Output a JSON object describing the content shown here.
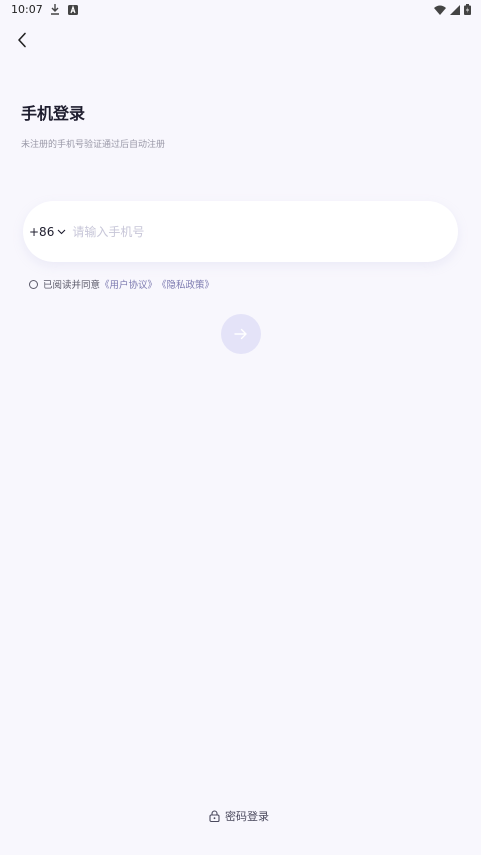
{
  "status_bar": {
    "time": "10:07"
  },
  "header": {
    "title": "手机登录",
    "subtitle": "未注册的手机号验证通过后自动注册"
  },
  "phone": {
    "country_code": "+86",
    "placeholder": "请输入手机号",
    "value": ""
  },
  "agreement": {
    "text": "已阅读并同意",
    "user_agreement": "《用户协议》",
    "privacy_policy": "《隐私政策》"
  },
  "footer": {
    "password_login": "密码登录"
  },
  "icons": {
    "back": "chevron-left-icon",
    "next": "arrow-right-icon",
    "lock": "lock-icon"
  },
  "colors": {
    "background": "#f8f7fd",
    "next_button": "#e4e3f8",
    "link": "#7c7ab0",
    "placeholder": "#c7c6d8"
  }
}
